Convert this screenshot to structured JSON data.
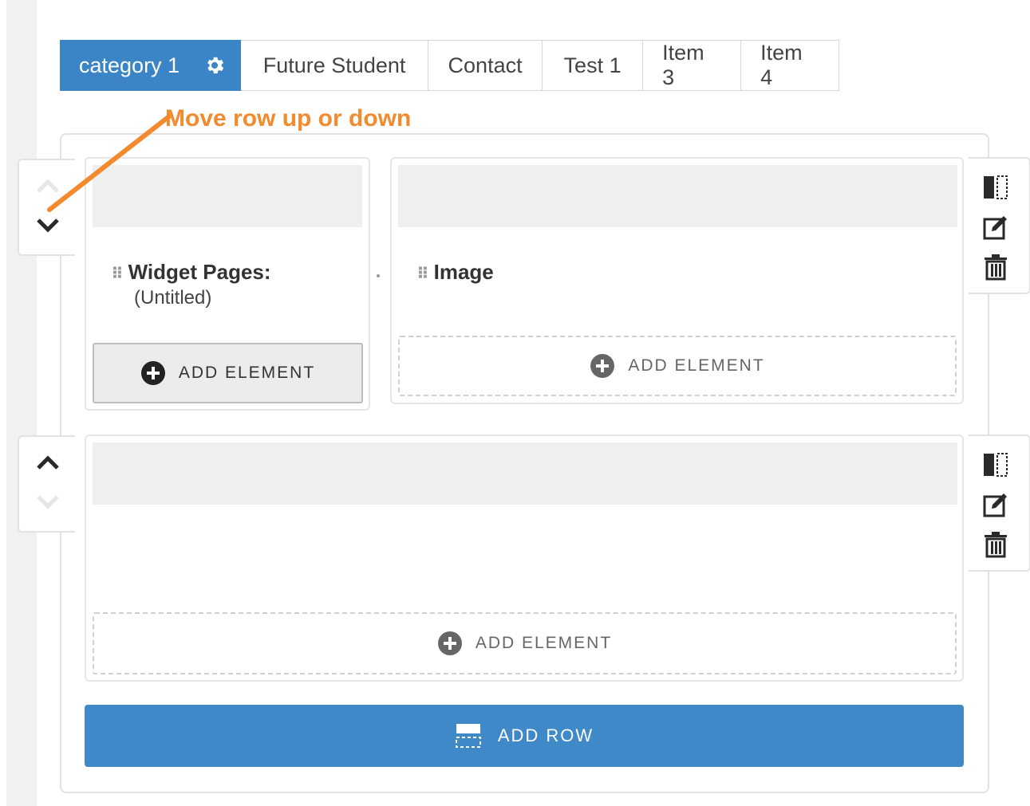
{
  "tabs": [
    {
      "label": "category 1",
      "active": true,
      "icon": "gear-icon"
    },
    {
      "label": "Future Student"
    },
    {
      "label": "Contact"
    },
    {
      "label": "Test 1"
    },
    {
      "label": "Item 3"
    },
    {
      "label": "Item 4"
    }
  ],
  "annotation": {
    "text": "Move row up or down",
    "color": "#f28a2e"
  },
  "rows": [
    {
      "columns": [
        {
          "widget_title": "Widget Pages:",
          "widget_subtitle": "(Untitled)",
          "add_label": "ADD ELEMENT"
        },
        {
          "widget_title": "Image",
          "add_label": "ADD ELEMENT"
        }
      ],
      "move_up_enabled": false,
      "move_down_enabled": true
    },
    {
      "columns": [
        {
          "add_label": "ADD ELEMENT"
        }
      ],
      "move_up_enabled": true,
      "move_down_enabled": false
    }
  ],
  "row_tools": [
    "columns-icon",
    "edit-icon",
    "trash-icon"
  ],
  "add_row": {
    "label": "ADD ROW",
    "icon": "add-row-icon"
  },
  "colors": {
    "accent": "#3b84c6",
    "button": "#3f89c9",
    "annotation": "#f28a2e"
  }
}
